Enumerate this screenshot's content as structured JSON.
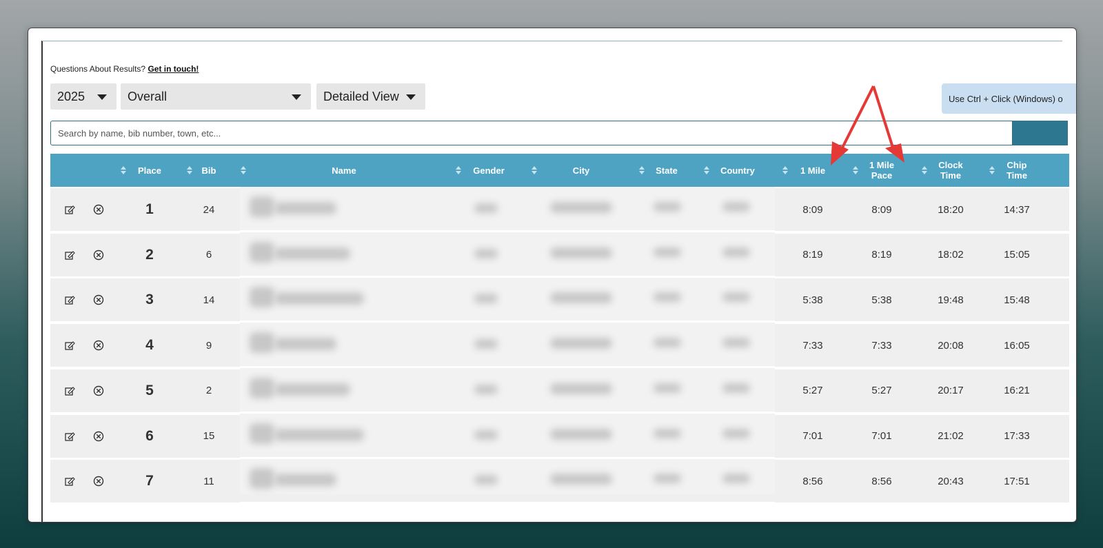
{
  "header": {
    "questions_text": "Questions About Results?",
    "contact_link": "Get in touch!"
  },
  "filters": {
    "year": "2025",
    "division": "Overall",
    "view": "Detailed View"
  },
  "hint": "Use Ctrl + Click (Windows) o",
  "search": {
    "placeholder": "Search by name, bib number, town, etc..."
  },
  "table": {
    "columns": [
      "Place",
      "Bib",
      "Name",
      "Gender",
      "City",
      "State",
      "Country",
      "1 Mile",
      "1 Mile Pace",
      "Clock Time",
      "Chip Time"
    ],
    "col_1mile_pace_lines": [
      "1 Mile",
      "Pace"
    ],
    "col_clock_lines": [
      "Clock",
      "Time"
    ],
    "col_chip_lines": [
      "Chip",
      "Time"
    ],
    "rows": [
      {
        "place": "1",
        "bib": "24",
        "mile": "8:09",
        "pace": "8:09",
        "clock": "18:20",
        "chip": "14:37"
      },
      {
        "place": "2",
        "bib": "6",
        "mile": "8:19",
        "pace": "8:19",
        "clock": "18:02",
        "chip": "15:05"
      },
      {
        "place": "3",
        "bib": "14",
        "mile": "5:38",
        "pace": "5:38",
        "clock": "19:48",
        "chip": "15:48"
      },
      {
        "place": "4",
        "bib": "9",
        "mile": "7:33",
        "pace": "7:33",
        "clock": "20:08",
        "chip": "16:05"
      },
      {
        "place": "5",
        "bib": "2",
        "mile": "5:27",
        "pace": "5:27",
        "clock": "20:17",
        "chip": "16:21"
      },
      {
        "place": "6",
        "bib": "15",
        "mile": "7:01",
        "pace": "7:01",
        "clock": "21:02",
        "chip": "17:33"
      },
      {
        "place": "7",
        "bib": "11",
        "mile": "8:56",
        "pace": "8:56",
        "clock": "20:43",
        "chip": "17:51"
      }
    ]
  },
  "icons": {
    "edit": "edit-icon",
    "remove": "remove-circle-icon"
  },
  "colors": {
    "header_bg": "#4ea3c3",
    "arrow": "#e53935",
    "search_button": "#2e7791"
  }
}
